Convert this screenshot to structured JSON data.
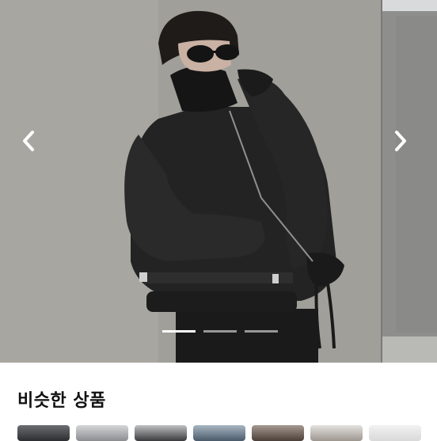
{
  "carousel": {
    "prev_icon": "chevron-left-icon",
    "next_icon": "chevron-right-icon",
    "slide_count": 3,
    "active_slide": 1
  },
  "similar": {
    "title": "비슷한 상품",
    "thumbnails": [
      "t1",
      "t2",
      "t3",
      "t4",
      "t5",
      "t6",
      "t7"
    ]
  },
  "colors": {
    "wall": "#9c9e99",
    "jacket": "#1f1f20",
    "accent_white": "#ffffff"
  }
}
